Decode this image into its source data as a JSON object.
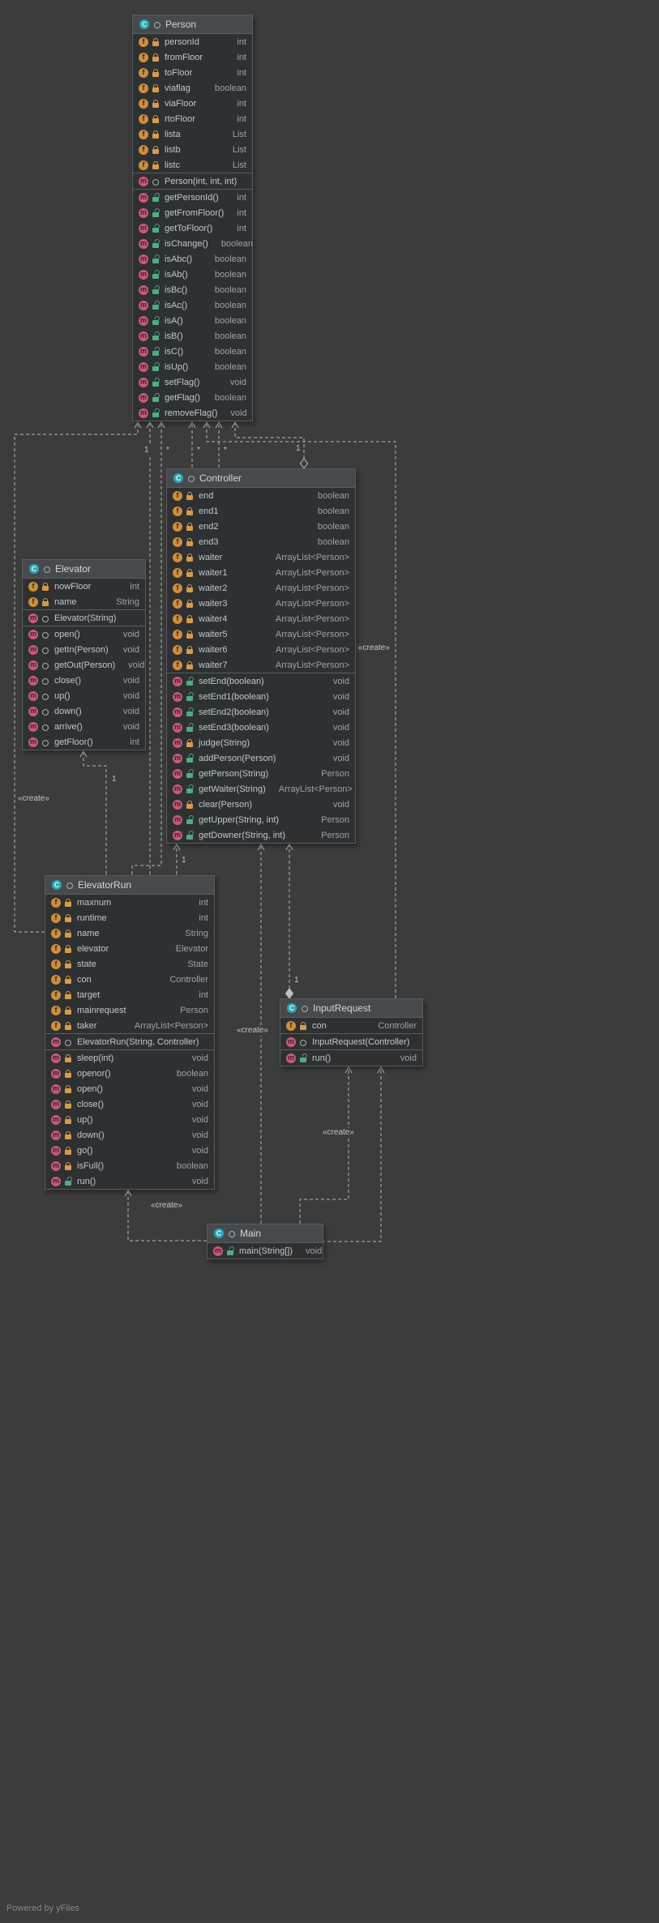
{
  "watermark": "Powered by yFiles",
  "labels": {
    "create": "«create»",
    "one": "1",
    "many": "*"
  },
  "classes": [
    {
      "id": "person",
      "name": "Person",
      "fields": [
        {
          "name": "personId",
          "type": "int",
          "vis": "private"
        },
        {
          "name": "fromFloor",
          "type": "int",
          "vis": "private"
        },
        {
          "name": "toFloor",
          "type": "int",
          "vis": "private"
        },
        {
          "name": "viaflag",
          "type": "boolean",
          "vis": "private"
        },
        {
          "name": "viaFloor",
          "type": "int",
          "vis": "private"
        },
        {
          "name": "rtoFloor",
          "type": "int",
          "vis": "private"
        },
        {
          "name": "lista",
          "type": "List",
          "vis": "private"
        },
        {
          "name": "listb",
          "type": "List",
          "vis": "private"
        },
        {
          "name": "listc",
          "type": "List",
          "vis": "private"
        }
      ],
      "ctors": [
        {
          "name": "Person(int, int, int)",
          "type": "",
          "vis": "package"
        }
      ],
      "methods": [
        {
          "name": "getPersonId()",
          "type": "int",
          "vis": "public"
        },
        {
          "name": "getFromFloor()",
          "type": "int",
          "vis": "public"
        },
        {
          "name": "getToFloor()",
          "type": "int",
          "vis": "public"
        },
        {
          "name": "isChange()",
          "type": "boolean",
          "vis": "public"
        },
        {
          "name": "isAbc()",
          "type": "boolean",
          "vis": "public"
        },
        {
          "name": "isAb()",
          "type": "boolean",
          "vis": "public"
        },
        {
          "name": "isBc()",
          "type": "boolean",
          "vis": "public"
        },
        {
          "name": "isAc()",
          "type": "boolean",
          "vis": "public"
        },
        {
          "name": "isA()",
          "type": "boolean",
          "vis": "public"
        },
        {
          "name": "isB()",
          "type": "boolean",
          "vis": "public"
        },
        {
          "name": "isC()",
          "type": "boolean",
          "vis": "public"
        },
        {
          "name": "isUp()",
          "type": "boolean",
          "vis": "public"
        },
        {
          "name": "setFlag()",
          "type": "void",
          "vis": "public"
        },
        {
          "name": "getFlag()",
          "type": "boolean",
          "vis": "public"
        },
        {
          "name": "removeFlag()",
          "type": "void",
          "vis": "public"
        }
      ]
    },
    {
      "id": "controller",
      "name": "Controller",
      "fields": [
        {
          "name": "end",
          "type": "boolean",
          "vis": "private"
        },
        {
          "name": "end1",
          "type": "boolean",
          "vis": "private"
        },
        {
          "name": "end2",
          "type": "boolean",
          "vis": "private"
        },
        {
          "name": "end3",
          "type": "boolean",
          "vis": "private"
        },
        {
          "name": "waiter",
          "type": "ArrayList<Person>",
          "vis": "private"
        },
        {
          "name": "waiter1",
          "type": "ArrayList<Person>",
          "vis": "private"
        },
        {
          "name": "waiter2",
          "type": "ArrayList<Person>",
          "vis": "private"
        },
        {
          "name": "waiter3",
          "type": "ArrayList<Person>",
          "vis": "private"
        },
        {
          "name": "waiter4",
          "type": "ArrayList<Person>",
          "vis": "private"
        },
        {
          "name": "waiter5",
          "type": "ArrayList<Person>",
          "vis": "private"
        },
        {
          "name": "waiter6",
          "type": "ArrayList<Person>",
          "vis": "private"
        },
        {
          "name": "waiter7",
          "type": "ArrayList<Person>",
          "vis": "private"
        }
      ],
      "ctors": [],
      "methods": [
        {
          "name": "setEnd(boolean)",
          "type": "void",
          "vis": "public"
        },
        {
          "name": "setEnd1(boolean)",
          "type": "void",
          "vis": "public"
        },
        {
          "name": "setEnd2(boolean)",
          "type": "void",
          "vis": "public"
        },
        {
          "name": "setEnd3(boolean)",
          "type": "void",
          "vis": "public"
        },
        {
          "name": "judge(String)",
          "type": "void",
          "vis": "private"
        },
        {
          "name": "addPerson(Person)",
          "type": "void",
          "vis": "public"
        },
        {
          "name": "getPerson(String)",
          "type": "Person",
          "vis": "public"
        },
        {
          "name": "getWaiter(String)",
          "type": "ArrayList<Person>",
          "vis": "public"
        },
        {
          "name": "clear(Person)",
          "type": "void",
          "vis": "private"
        },
        {
          "name": "getUpper(String, int)",
          "type": "Person",
          "vis": "public"
        },
        {
          "name": "getDowner(String, int)",
          "type": "Person",
          "vis": "public"
        }
      ]
    },
    {
      "id": "elevator",
      "name": "Elevator",
      "fields": [
        {
          "name": "nowFloor",
          "type": "int",
          "vis": "private"
        },
        {
          "name": "name",
          "type": "String",
          "vis": "private"
        }
      ],
      "ctors": [
        {
          "name": "Elevator(String)",
          "type": "",
          "vis": "package"
        }
      ],
      "methods": [
        {
          "name": "open()",
          "type": "void",
          "vis": "package"
        },
        {
          "name": "getIn(Person)",
          "type": "void",
          "vis": "package"
        },
        {
          "name": "getOut(Person)",
          "type": "void",
          "vis": "package"
        },
        {
          "name": "close()",
          "type": "void",
          "vis": "package"
        },
        {
          "name": "up()",
          "type": "void",
          "vis": "package"
        },
        {
          "name": "down()",
          "type": "void",
          "vis": "package"
        },
        {
          "name": "arrive()",
          "type": "void",
          "vis": "package"
        },
        {
          "name": "getFloor()",
          "type": "int",
          "vis": "package"
        }
      ]
    },
    {
      "id": "elevatorrun",
      "name": "ElevatorRun",
      "fields": [
        {
          "name": "maxnum",
          "type": "int",
          "vis": "private"
        },
        {
          "name": "runtime",
          "type": "int",
          "vis": "private"
        },
        {
          "name": "name",
          "type": "String",
          "vis": "private"
        },
        {
          "name": "elevator",
          "type": "Elevator",
          "vis": "private"
        },
        {
          "name": "state",
          "type": "State",
          "vis": "private"
        },
        {
          "name": "con",
          "type": "Controller",
          "vis": "private"
        },
        {
          "name": "target",
          "type": "int",
          "vis": "private"
        },
        {
          "name": "mainrequest",
          "type": "Person",
          "vis": "private"
        },
        {
          "name": "taker",
          "type": "ArrayList<Person>",
          "vis": "private"
        }
      ],
      "ctors": [
        {
          "name": "ElevatorRun(String, Controller)",
          "type": "",
          "vis": "package"
        }
      ],
      "methods": [
        {
          "name": "sleep(int)",
          "type": "void",
          "vis": "private"
        },
        {
          "name": "openor()",
          "type": "boolean",
          "vis": "private"
        },
        {
          "name": "open()",
          "type": "void",
          "vis": "private"
        },
        {
          "name": "close()",
          "type": "void",
          "vis": "private"
        },
        {
          "name": "up()",
          "type": "void",
          "vis": "private"
        },
        {
          "name": "down()",
          "type": "void",
          "vis": "private"
        },
        {
          "name": "go()",
          "type": "void",
          "vis": "private"
        },
        {
          "name": "isFull()",
          "type": "boolean",
          "vis": "private"
        },
        {
          "name": "run()",
          "type": "void",
          "vis": "public"
        }
      ]
    },
    {
      "id": "inputrequest",
      "name": "InputRequest",
      "fields": [
        {
          "name": "con",
          "type": "Controller",
          "vis": "private"
        }
      ],
      "ctors": [
        {
          "name": "InputRequest(Controller)",
          "type": "",
          "vis": "package"
        }
      ],
      "methods": [
        {
          "name": "run()",
          "type": "void",
          "vis": "public"
        }
      ]
    },
    {
      "id": "main",
      "name": "Main",
      "fields": [],
      "ctors": [],
      "methods": [
        {
          "name": "main(String[])",
          "type": "void",
          "vis": "public"
        }
      ]
    }
  ]
}
